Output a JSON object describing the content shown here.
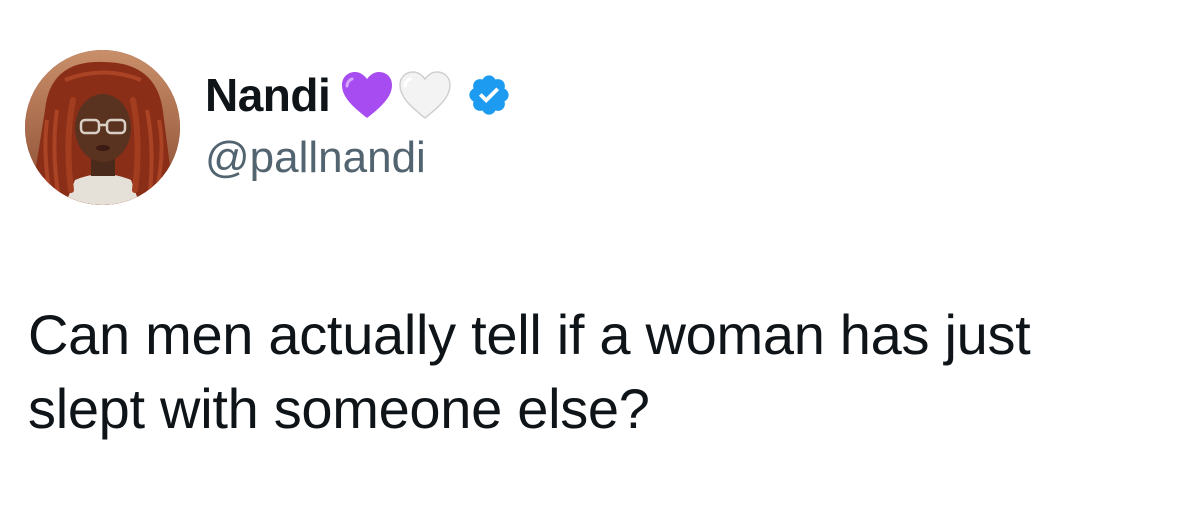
{
  "author": {
    "display_name": "Nandi",
    "handle": "@pallnandi",
    "verified": true,
    "name_emojis": [
      "purple-heart",
      "white-heart"
    ]
  },
  "tweet": {
    "text": "Can men actually tell if a woman has just slept with someone else?"
  },
  "colors": {
    "text_primary": "#0f1419",
    "text_secondary": "#536471",
    "verified_blue": "#1d9bf0",
    "purple_heart": "#a64cf0"
  }
}
